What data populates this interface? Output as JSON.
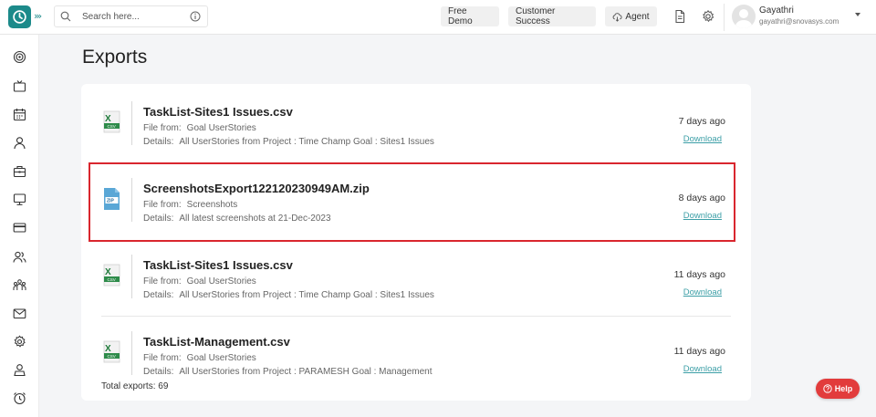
{
  "header": {
    "search_placeholder": "Search here...",
    "free_demo": "Free Demo",
    "customer_success": "Customer Success",
    "agent": "Agent",
    "user_name": "Gayathri",
    "user_email": "gayathri@snovasys.com"
  },
  "sidebar": {
    "icons": [
      "target-icon",
      "tv-icon",
      "calendar-icon",
      "user-icon",
      "briefcase-icon",
      "monitor-icon",
      "card-icon",
      "users-icon",
      "team-icon",
      "mail-icon",
      "gear-icon",
      "person-icon",
      "alarm-icon"
    ]
  },
  "page": {
    "title": "Exports"
  },
  "exports": [
    {
      "file_name": "TaskList-Sites1 Issues.csv",
      "type": "csv",
      "from_label": "File from:",
      "from_value": "Goal UserStories",
      "details_label": "Details:",
      "details_value": "All UserStories from Project : Time Champ Goal : Sites1 Issues",
      "age": "7 days ago",
      "download": "Download"
    },
    {
      "file_name": "ScreenshotsExport122120230949AM.zip",
      "type": "zip",
      "from_label": "File from:",
      "from_value": "Screenshots",
      "details_label": "Details:",
      "details_value": "All latest screenshots at 21-Dec-2023",
      "age": "8 days ago",
      "download": "Download"
    },
    {
      "file_name": "TaskList-Sites1 Issues.csv",
      "type": "csv",
      "from_label": "File from:",
      "from_value": "Goal UserStories",
      "details_label": "Details:",
      "details_value": "All UserStories from Project : Time Champ Goal : Sites1 Issues",
      "age": "11 days ago",
      "download": "Download"
    },
    {
      "file_name": "TaskList-Management.csv",
      "type": "csv",
      "from_label": "File from:",
      "from_value": "Goal UserStories",
      "details_label": "Details:",
      "details_value": "All UserStories from Project : PARAMESH Goal : Management",
      "age": "11 days ago",
      "download": "Download"
    }
  ],
  "footer": {
    "total": "Total exports: 69"
  },
  "help": {
    "label": "Help"
  },
  "colors": {
    "accent": "#1c8a8a",
    "link": "#3d9fa7",
    "highlight": "#d9262e",
    "help": "#e23c3c"
  }
}
